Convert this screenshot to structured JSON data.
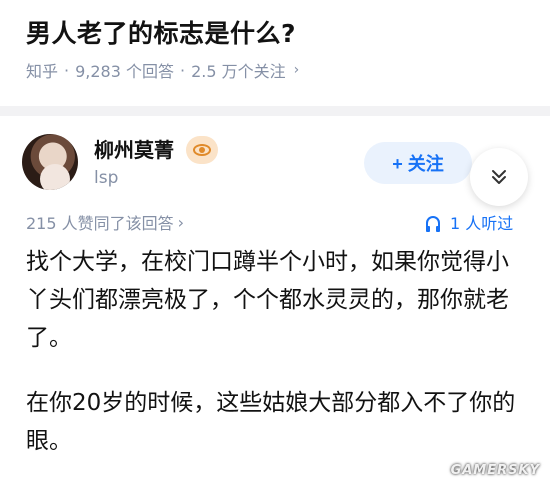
{
  "question": {
    "title": "男人老了的标志是什么?",
    "source": "知乎",
    "answer_count": "9,283 个回答",
    "follower_count": "2.5 万个关注",
    "separator": "·",
    "chevron": "›"
  },
  "author": {
    "name": "柳州莫菁",
    "subtitle": "lsp",
    "avatar_icon": "avatar-photo",
    "badge_icon": "eye-icon",
    "follow_label": "+ 关注",
    "expand_icon": "chevron-double-down-icon",
    "expand_glyph": "»"
  },
  "stats": {
    "likes": "215 人赞同了该回答",
    "likes_chevron": "›",
    "listeners": "1 人听过",
    "listen_icon": "headphone-icon"
  },
  "answer": {
    "paragraphs": [
      "找个大学，在校门口蹲半个小时，如果你觉得小丫头们都漂亮极了，个个都水灵灵的，那你就老了。",
      "在你20岁的时候，这些姑娘大部分都入不了你的眼。"
    ]
  },
  "watermark": "GAMERSKY",
  "colors": {
    "accent": "#1772f6",
    "meta": "#8590a6",
    "badge": "#e08a2a"
  }
}
